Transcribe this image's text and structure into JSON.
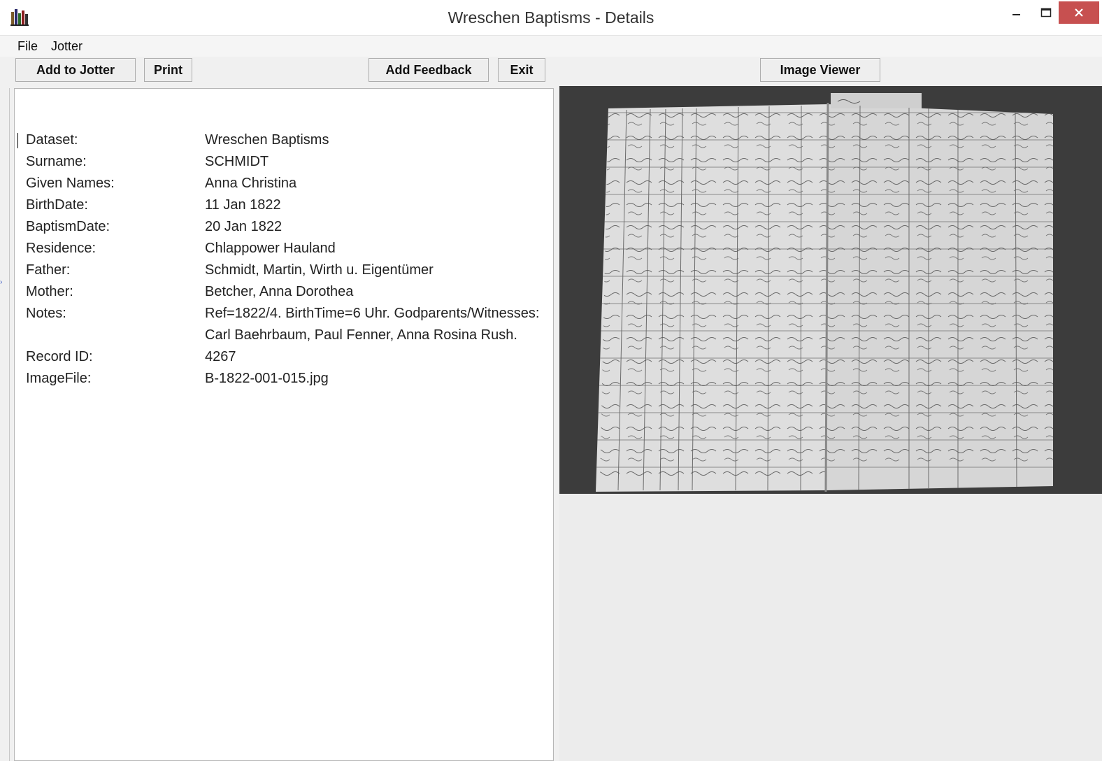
{
  "window": {
    "title": "Wreschen Baptisms - Details",
    "controls": {
      "minimize": "–",
      "maximize": "▭",
      "close": "✕"
    }
  },
  "menu": {
    "file": "File",
    "jotter": "Jotter"
  },
  "toolbar": {
    "add_to_jotter": "Add to Jotter",
    "print": "Print",
    "add_feedback": "Add Feedback",
    "exit": "Exit",
    "image_viewer": "Image Viewer"
  },
  "record": {
    "fields": [
      {
        "label": "Dataset:",
        "value": "Wreschen Baptisms"
      },
      {
        "label": "Surname:",
        "value": "SCHMIDT"
      },
      {
        "label": "Given Names:",
        "value": "Anna Christina"
      },
      {
        "label": "BirthDate:",
        "value": "11 Jan 1822"
      },
      {
        "label": "BaptismDate:",
        "value": "20 Jan 1822"
      },
      {
        "label": "Residence:",
        "value": "Chlappower Hauland"
      },
      {
        "label": "Father:",
        "value": "Schmidt, Martin, Wirth u. Eigentümer"
      },
      {
        "label": "Mother:",
        "value": "Betcher, Anna Dorothea"
      },
      {
        "label": "Notes:",
        "value": "Ref=1822/4. BirthTime=6 Uhr. Godparents/Witnesses:"
      },
      {
        "label": "",
        "value": "Carl Baehrbaum, Paul Fenner, Anna Rosina Rush."
      },
      {
        "label": "Record ID:",
        "value": "4267"
      },
      {
        "label": "ImageFile:",
        "value": "B-1822-001-015.jpg"
      }
    ]
  },
  "colors": {
    "close_button": "#c75050",
    "panel_bg": "#ffffff",
    "window_bg": "#f0f0f0",
    "scan_bg": "#3a3a3a"
  }
}
